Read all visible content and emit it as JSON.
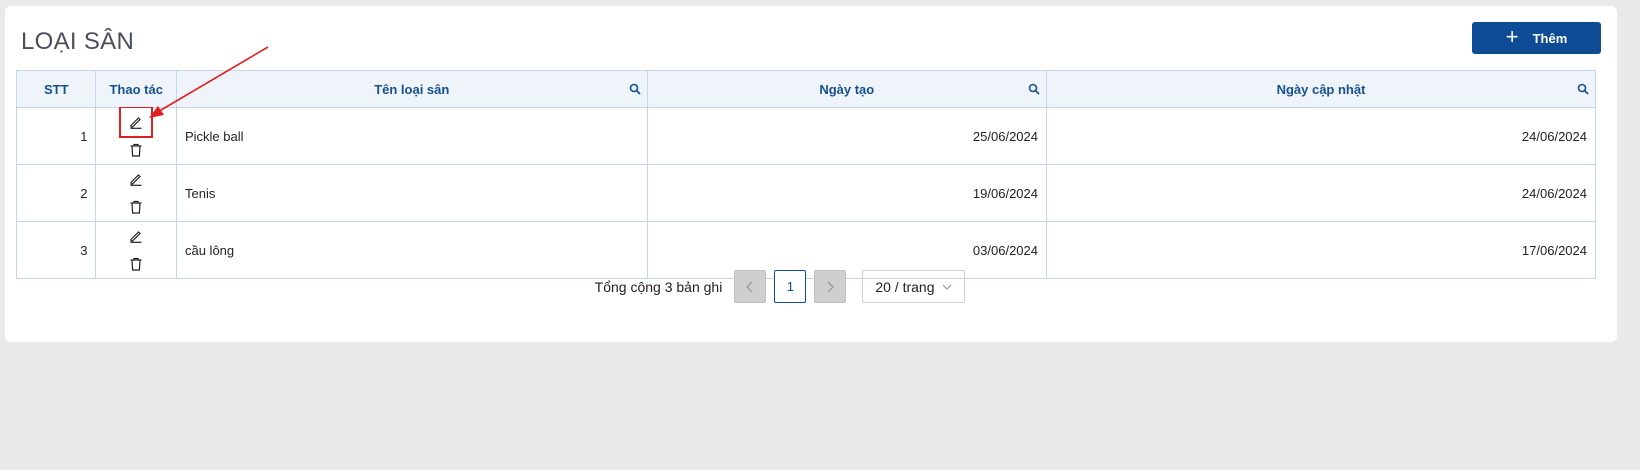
{
  "header": {
    "title": "LOẠI SÂN",
    "add_label": "Thêm"
  },
  "table": {
    "columns": [
      "STT",
      "Thao tác",
      "Tên loại sân",
      "Ngày tạo",
      "Ngày cập nhật"
    ],
    "rows": [
      {
        "stt": "1",
        "name": "Pickle ball",
        "created": "25/06/2024",
        "updated": "24/06/2024"
      },
      {
        "stt": "2",
        "name": "Tenis",
        "created": "19/06/2024",
        "updated": "24/06/2024"
      },
      {
        "stt": "3",
        "name": "cầu lông",
        "created": "03/06/2024",
        "updated": "17/06/2024"
      }
    ]
  },
  "pagination": {
    "total_text": "Tổng cộng 3 bản ghi",
    "current_page": "1",
    "page_size": "20 / trang"
  },
  "colors": {
    "primary": "#0e4d95",
    "header_text": "#17518f",
    "header_bg": "#eef4fa",
    "annotation": "#e02020"
  },
  "icons": {
    "search": "search-icon",
    "edit": "edit-icon",
    "delete": "trash-icon",
    "add": "plus-icon"
  }
}
